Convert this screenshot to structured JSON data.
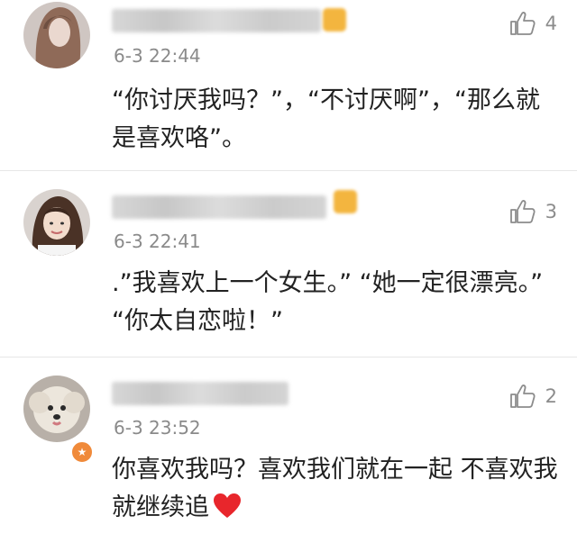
{
  "comments": [
    {
      "time": "6-3 22:44",
      "likes": "4",
      "text": "“你讨厌我吗？”，“不讨厌啊”，“那么就是喜欢咯”。",
      "avatar": "long-hair-woman",
      "has_vip_badge": true
    },
    {
      "time": "6-3 22:41",
      "likes": "3",
      "text": ".”我喜欢上一个女生。” “她一定很漂亮。” “你太自恋啦！”",
      "avatar": "smiling-woman",
      "has_vip_badge": true
    },
    {
      "time": "6-3 23:52",
      "likes": "2",
      "text": "你喜欢我吗？喜欢我们就在一起 不喜欢我就继续追",
      "avatar": "fluffy-dog",
      "has_vip_badge": false,
      "trailing_icon": "red-heart-emoji"
    }
  ],
  "colors": {
    "time": "#8a8a8a",
    "like": "#8c8c8c",
    "heart": "#e8262c",
    "badge": "#f08a3a"
  }
}
